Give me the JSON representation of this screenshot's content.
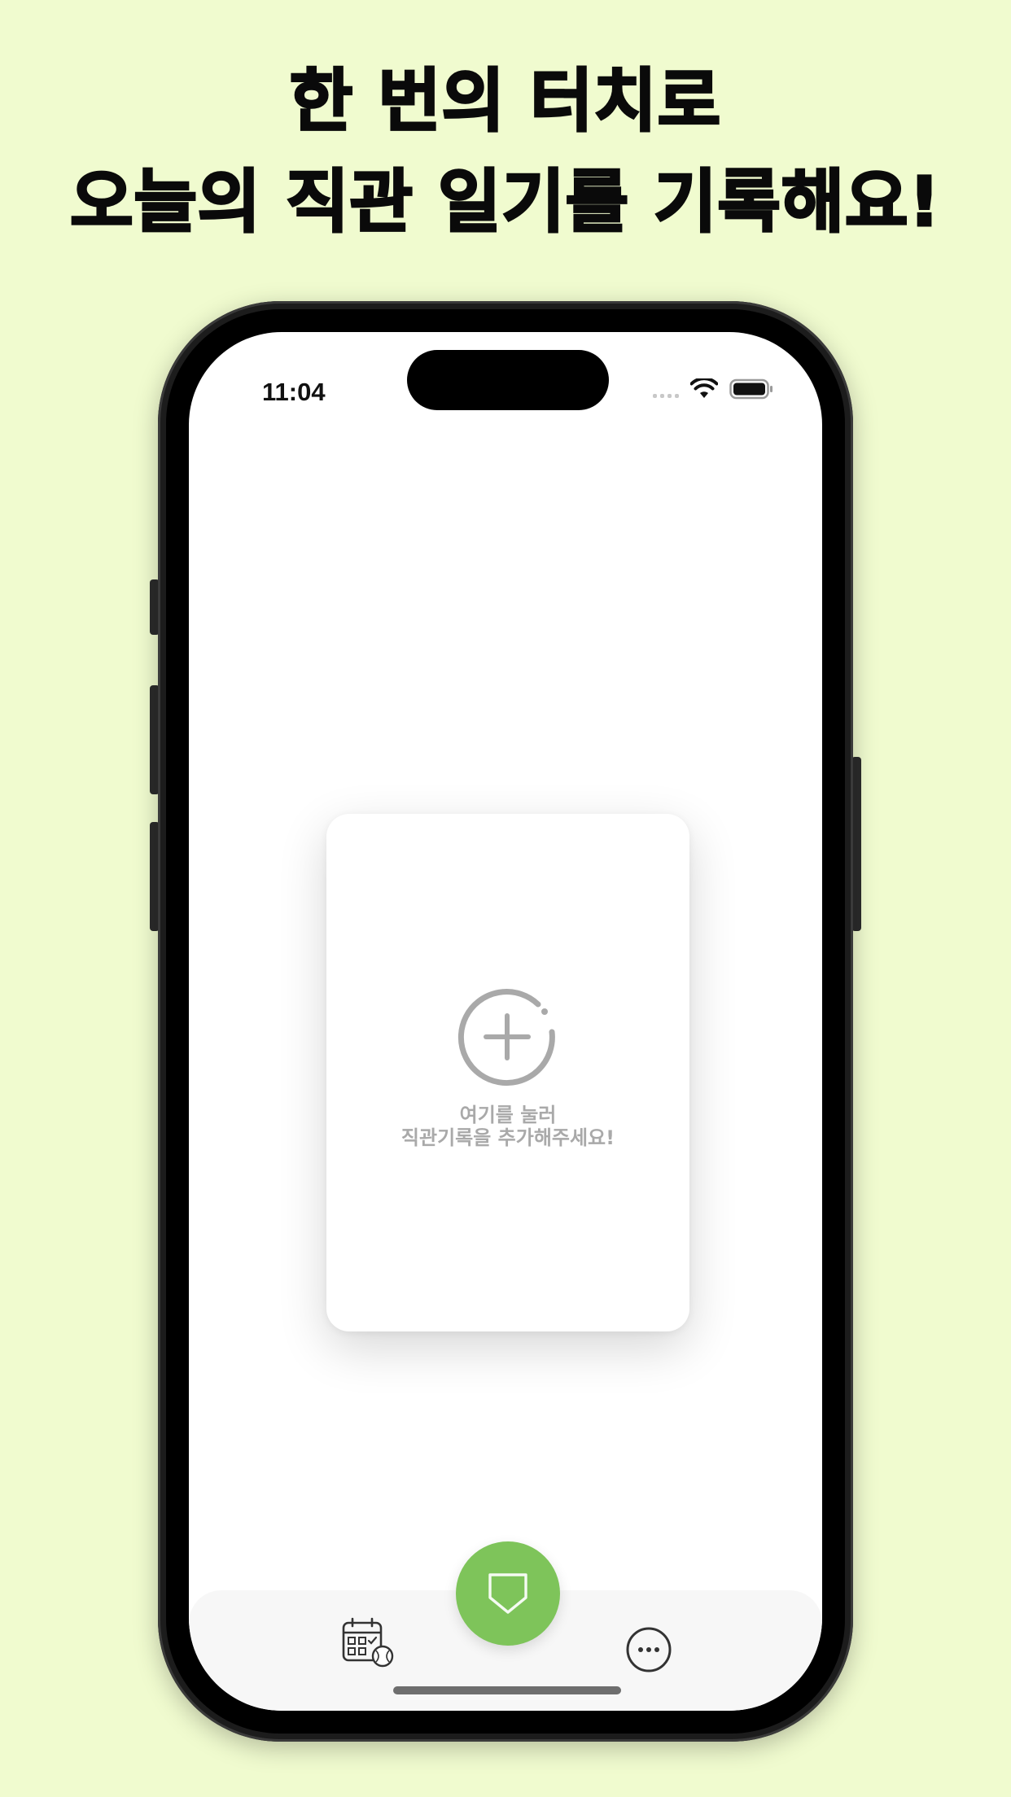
{
  "headline": {
    "line1": "한 번의 터치로",
    "line2": "오늘의 직관 일기를 기록해요!"
  },
  "status_bar": {
    "time": "11:04",
    "icons": [
      "cellular-signal-icon",
      "wifi-icon",
      "battery-icon"
    ]
  },
  "card": {
    "icon": "add-circle-icon",
    "line1": "여기를 눌러",
    "line2": "직관기록을 추가해주세요!"
  },
  "tab_bar": {
    "left_icon": "calendar-baseball-icon",
    "center_icon": "home-plate-icon",
    "right_icon": "more-icon"
  },
  "colors": {
    "background": "#f0fbcf",
    "accent_green": "#7ec45a",
    "placeholder_gray": "#a9a9a9"
  }
}
